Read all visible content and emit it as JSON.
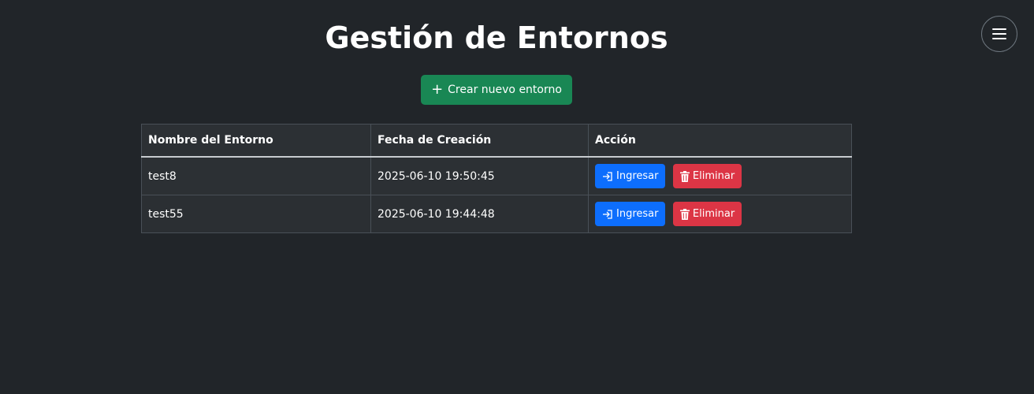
{
  "page": {
    "title": "Gestión de Entornos"
  },
  "menu": {
    "icon": "hamburger-menu-icon"
  },
  "create_button": {
    "icon": "plus-icon",
    "label": "Crear nuevo entorno"
  },
  "table": {
    "headers": [
      "Nombre del Entorno",
      "Fecha de Creación",
      "Acción"
    ],
    "rows": [
      {
        "name": "test8",
        "created": "2025-06-10 19:50:45",
        "enter_label": "Ingresar",
        "delete_label": "Eliminar"
      },
      {
        "name": "test55",
        "created": "2025-06-10 19:44:48",
        "enter_label": "Ingresar",
        "delete_label": "Eliminar"
      }
    ]
  },
  "colors": {
    "background": "#212529",
    "success": "#198754",
    "primary": "#0d6efd",
    "danger": "#dc3545"
  }
}
